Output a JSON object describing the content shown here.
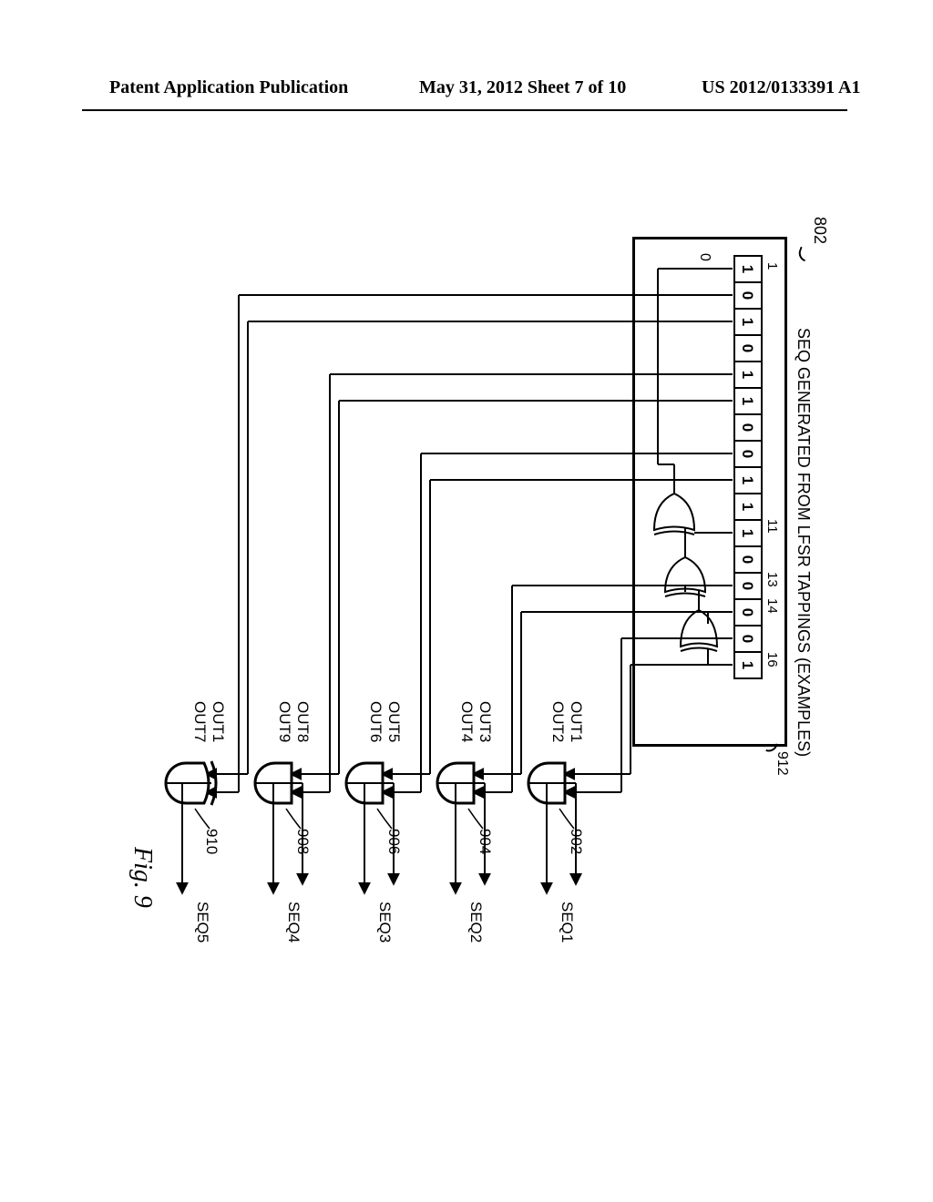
{
  "header": {
    "left": "Patent Application Publication",
    "mid": "May 31, 2012  Sheet 7 of 10",
    "right": "US 2012/0133391 A1"
  },
  "title": "SEQ GENERATED FROM LFSR TAPPINGS (EXAMPLES)",
  "figure_label": "Fig. 9",
  "refs": {
    "block": "802",
    "lfsr_hook": "912",
    "feedback_zero": "0"
  },
  "lfsr_bits": [
    "1",
    "0",
    "1",
    "0",
    "1",
    "1",
    "0",
    "0",
    "1",
    "1",
    "1",
    "0",
    "0",
    "0",
    "0",
    "1"
  ],
  "bit_indices": [
    {
      "pos": 1,
      "label": "1"
    },
    {
      "pos": 11,
      "label": "11"
    },
    {
      "pos": 13,
      "label": "13"
    },
    {
      "pos": 14,
      "label": "14"
    },
    {
      "pos": 16,
      "label": "16"
    }
  ],
  "gates": [
    {
      "id": "g1",
      "ref": "902",
      "type": "and",
      "inA": "OUT1",
      "inB": "OUT2",
      "out": "SEQ1"
    },
    {
      "id": "g2",
      "ref": "904",
      "type": "and",
      "inA": "OUT3",
      "inB": "OUT4",
      "out": "SEQ2"
    },
    {
      "id": "g3",
      "ref": "906",
      "type": "and",
      "inA": "OUT5",
      "inB": "OUT6",
      "out": "SEQ3"
    },
    {
      "id": "g4",
      "ref": "908",
      "type": "and",
      "inA": "OUT8",
      "inB": "OUT9",
      "out": "SEQ4"
    },
    {
      "id": "g5",
      "ref": "910",
      "type": "xor",
      "inA": "OUT1",
      "inB": "OUT7",
      "out": "SEQ5"
    }
  ]
}
